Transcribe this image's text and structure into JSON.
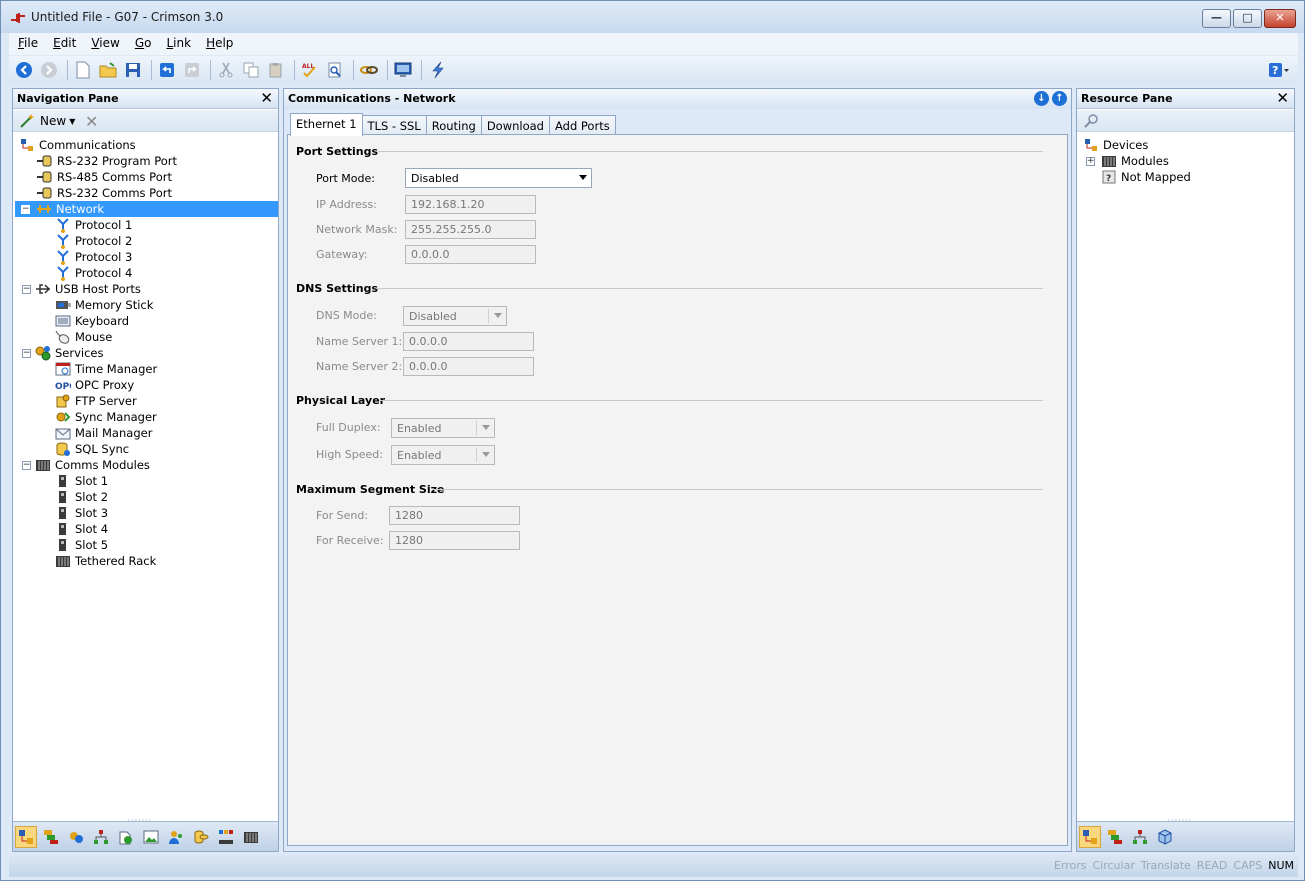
{
  "window": {
    "title": "Untitled File - G07 - Crimson 3.0"
  },
  "menu": [
    {
      "u": "F",
      "rest": "ile"
    },
    {
      "u": "E",
      "rest": "dit"
    },
    {
      "u": "V",
      "rest": "iew"
    },
    {
      "u": "G",
      "rest": "o"
    },
    {
      "u": "L",
      "rest": "ink"
    },
    {
      "u": "H",
      "rest": "elp"
    }
  ],
  "nav_pane": {
    "title": "Navigation Pane",
    "new_label": "New",
    "tree": {
      "communications": "Communications",
      "rs232_program": "RS-232 Program Port",
      "rs485_comms": "RS-485 Comms Port",
      "rs232_comms": "RS-232 Comms Port",
      "network": "Network",
      "protocol1": "Protocol 1",
      "protocol2": "Protocol 2",
      "protocol3": "Protocol 3",
      "protocol4": "Protocol 4",
      "usb_host": "USB Host Ports",
      "memory_stick": "Memory Stick",
      "keyboard": "Keyboard",
      "mouse": "Mouse",
      "services": "Services",
      "time_manager": "Time Manager",
      "opc_proxy": "OPC Proxy",
      "ftp_server": "FTP Server",
      "sync_manager": "Sync Manager",
      "mail_manager": "Mail Manager",
      "sql_sync": "SQL Sync",
      "comms_modules": "Comms Modules",
      "slot1": "Slot 1",
      "slot2": "Slot 2",
      "slot3": "Slot 3",
      "slot4": "Slot 4",
      "slot5": "Slot 5",
      "tethered_rack": "Tethered Rack"
    }
  },
  "center": {
    "title": "Communications - Network",
    "tabs": [
      "Ethernet 1",
      "TLS - SSL",
      "Routing",
      "Download",
      "Add Ports"
    ],
    "port_settings": {
      "title": "Port Settings",
      "port_mode_label": "Port Mode:",
      "port_mode_value": "Disabled",
      "ip_label": "IP Address:",
      "ip_value": "192.168.1.20",
      "mask_label": "Network Mask:",
      "mask_value": "255.255.255.0",
      "gateway_label": "Gateway:",
      "gateway_value": "0.0.0.0"
    },
    "dns_settings": {
      "title": "DNS Settings",
      "mode_label": "DNS Mode:",
      "mode_value": "Disabled",
      "ns1_label": "Name Server 1:",
      "ns1_value": "0.0.0.0",
      "ns2_label": "Name Server 2:",
      "ns2_value": "0.0.0.0"
    },
    "physical_layer": {
      "title": "Physical Layer",
      "duplex_label": "Full Duplex:",
      "duplex_value": "Enabled",
      "speed_label": "High Speed:",
      "speed_value": "Enabled"
    },
    "mss": {
      "title": "Maximum Segment Size",
      "send_label": "For Send:",
      "send_value": "1280",
      "recv_label": "For Receive:",
      "recv_value": "1280"
    }
  },
  "resource_pane": {
    "title": "Resource Pane",
    "tree": {
      "devices": "Devices",
      "modules": "Modules",
      "not_mapped": "Not Mapped"
    }
  },
  "status": {
    "errors": "Errors",
    "circular": "Circular",
    "translate": "Translate",
    "read": "READ",
    "caps": "CAPS",
    "num": "NUM"
  },
  "colors": {
    "selection": "#3399ff",
    "accent_blue": "#1e6fd6",
    "frame": "#dde9f6"
  }
}
